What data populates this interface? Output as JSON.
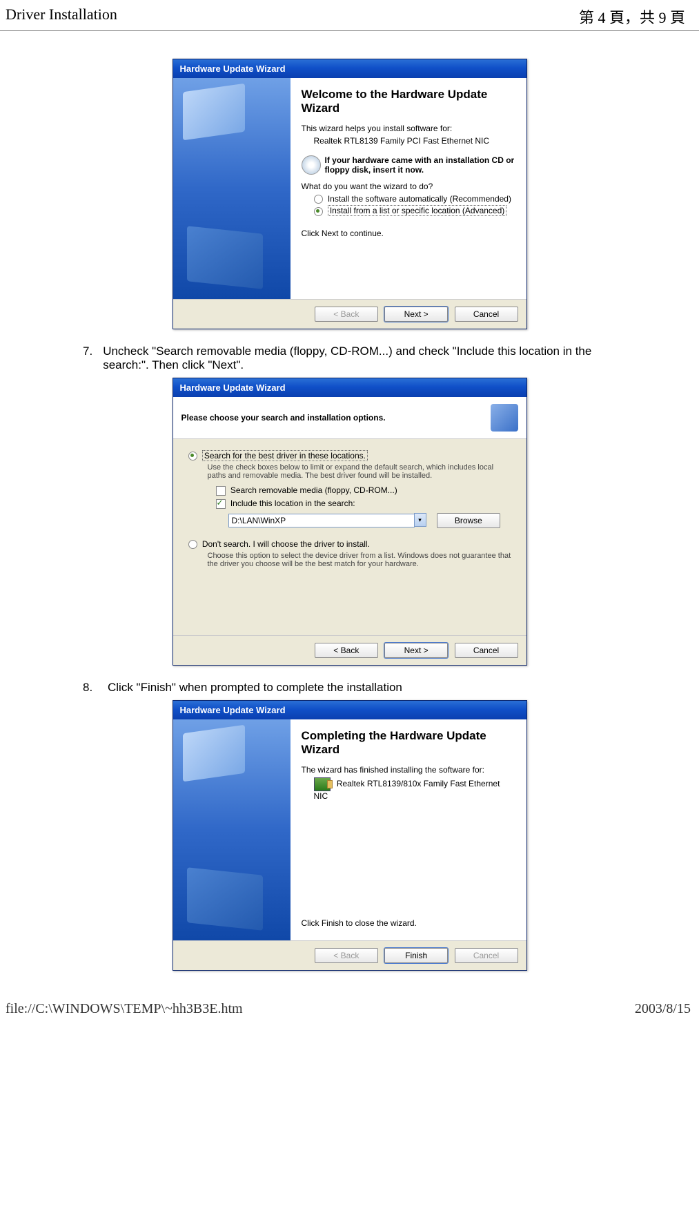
{
  "header": {
    "left": "Driver Installation",
    "right": "第 4 頁，共 9 頁"
  },
  "footer": {
    "left": "file://C:\\WINDOWS\\TEMP\\~hh3B3E.htm",
    "right": "2003/8/15"
  },
  "step7": {
    "num": "7.",
    "text": "Uncheck \"Search removable media (floppy, CD-ROM...) and check \"Include this location in the search:\". Then click \"Next\"."
  },
  "step8": {
    "num": "8.",
    "text": "Click \"Finish\" when prompted to complete the installation"
  },
  "dlg1": {
    "title": "Hardware Update Wizard",
    "heading": "Welcome to the Hardware Update Wizard",
    "intro": "This wizard helps you install software for:",
    "device": "Realtek RTL8139 Family PCI Fast Ethernet NIC",
    "cd": "If your hardware came with an installation CD or floppy disk, insert it now.",
    "question": "What do you want the wizard to do?",
    "opt1": "Install the software automatically (Recommended)",
    "opt2": "Install from a list or specific location (Advanced)",
    "cont": "Click Next to continue.",
    "back": "< Back",
    "next": "Next >",
    "cancel": "Cancel"
  },
  "dlg2": {
    "title": "Hardware Update Wizard",
    "header": "Please choose your search and installation options.",
    "opt1": "Search for the best driver in these locations.",
    "opt1_sub": "Use the check boxes below to limit or expand the default search, which includes local paths and removable media. The best driver found will be installed.",
    "chk1": "Search removable media (floppy, CD-ROM...)",
    "chk2": "Include this location in the search:",
    "path": "D:\\LAN\\WinXP",
    "browse": "Browse",
    "opt2": "Don't search. I will choose the driver to install.",
    "opt2_sub": "Choose this option to select the device driver from a list.  Windows does not guarantee that the driver you choose will be the best match for your hardware.",
    "back": "< Back",
    "next": "Next >",
    "cancel": "Cancel"
  },
  "dlg3": {
    "title": "Hardware Update Wizard",
    "heading": "Completing the Hardware Update Wizard",
    "intro": "The wizard has finished installing the software for:",
    "device": "Realtek RTL8139/810x Family Fast Ethernet NIC",
    "cont": "Click Finish to close the wizard.",
    "back": "< Back",
    "finish": "Finish",
    "cancel": "Cancel"
  }
}
